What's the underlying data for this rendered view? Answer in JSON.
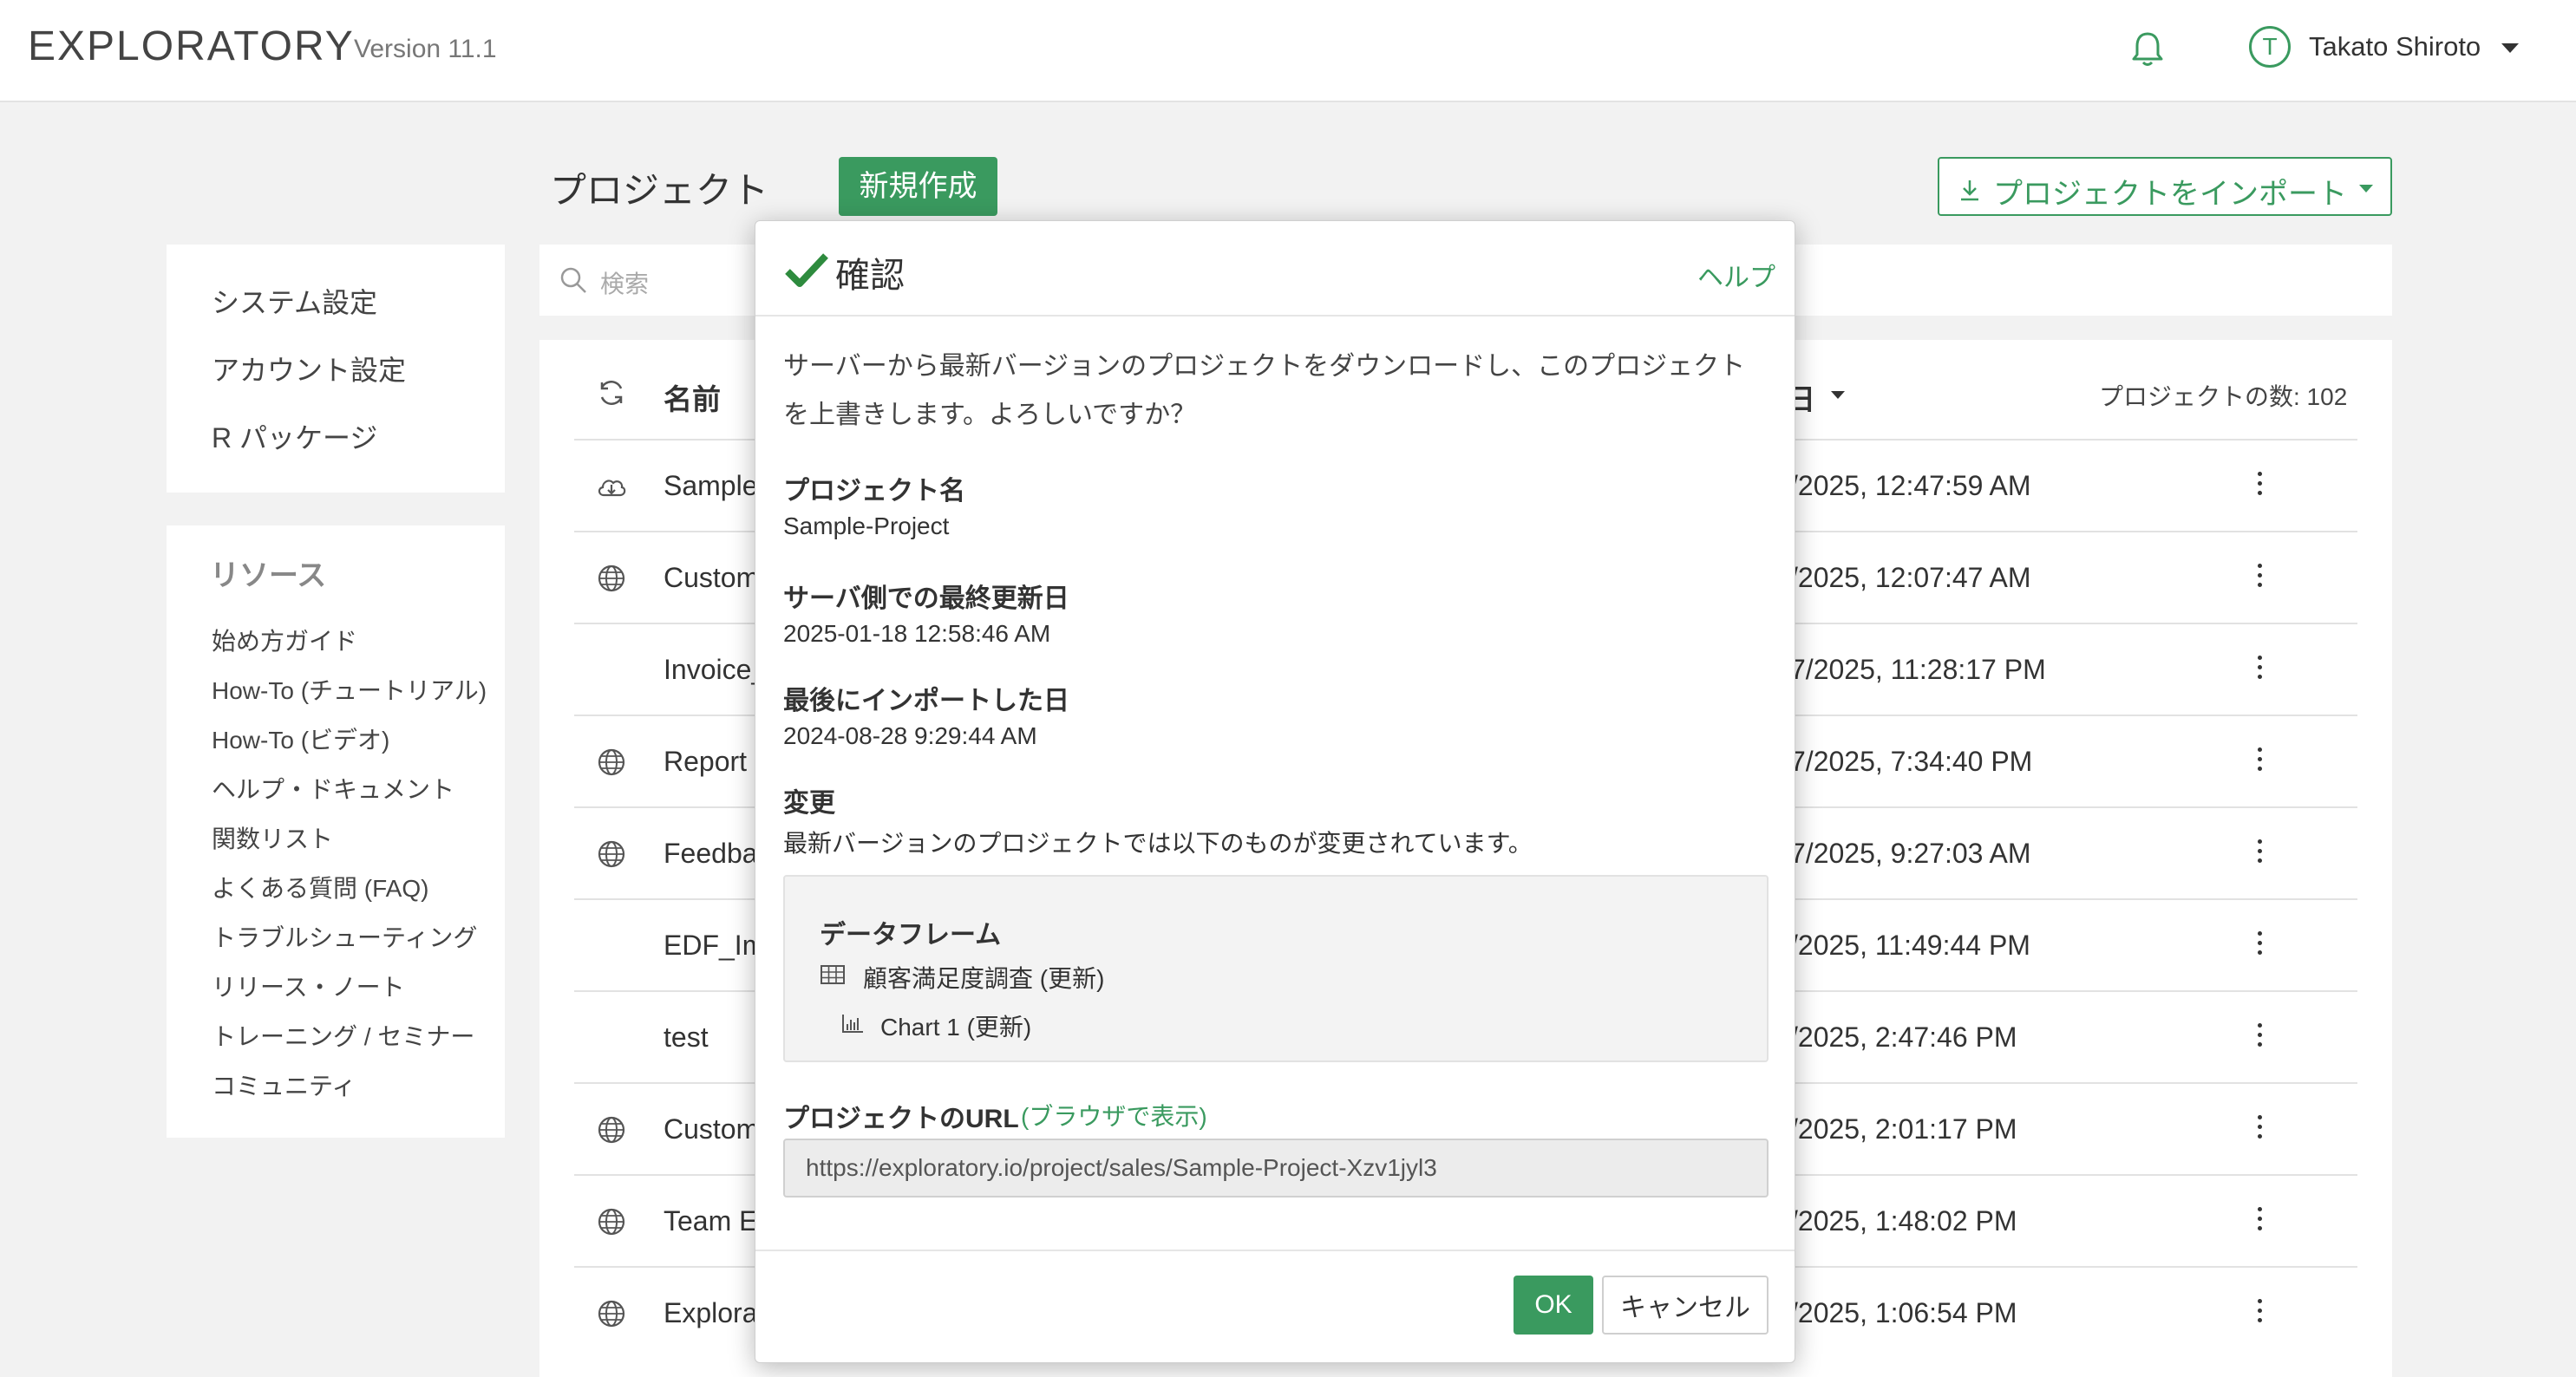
{
  "header": {
    "brand": "EXPLORATORY",
    "version": "Version 11.1",
    "user_initial": "T",
    "user_name": "Takato Shiroto"
  },
  "toolbar": {
    "page_title": "プロジェクト",
    "new_label": "新規作成",
    "import_label": "プロジェクトをインポート"
  },
  "sidebar": {
    "settings": [
      "システム設定",
      "アカウント設定",
      "R パッケージ"
    ],
    "resources_heading": "リソース",
    "resources": [
      "始め方ガイド",
      "How-To (チュートリアル)",
      "How-To (ビデオ)",
      "ヘルプ・ドキュメント",
      "関数リスト",
      "よくある質問 (FAQ)",
      "トラブルシューティング",
      "リリース・ノート",
      "トレーニング / セミナー",
      "コミュニティ"
    ]
  },
  "search": {
    "placeholder": "検索"
  },
  "table": {
    "col_name": "名前",
    "col_date": "日",
    "count_label": "プロジェクトの数: 102",
    "rows": [
      {
        "icon": "cloud-download-icon",
        "name": "Sample",
        "date": "/2025, 12:47:59 AM"
      },
      {
        "icon": "globe-icon",
        "name": "Custom",
        "date": "/2025, 12:07:47 AM"
      },
      {
        "icon": "",
        "name": "Invoice_",
        "date": "7/2025, 11:28:17 PM"
      },
      {
        "icon": "globe-icon",
        "name": "Report",
        "date": "7/2025, 7:34:40 PM"
      },
      {
        "icon": "globe-icon",
        "name": "Feedba",
        "date": "7/2025, 9:27:03 AM"
      },
      {
        "icon": "",
        "name": "EDF_Im",
        "date": "/2025, 11:49:44 PM"
      },
      {
        "icon": "",
        "name": "test",
        "date": "/2025, 2:47:46 PM"
      },
      {
        "icon": "globe-icon",
        "name": "Custom",
        "date": "/2025, 2:01:17 PM"
      },
      {
        "icon": "globe-icon",
        "name": "Team E",
        "date": "/2025, 1:48:02 PM"
      },
      {
        "icon": "globe-icon",
        "name": "Explora",
        "date": "/2025, 1:06:54 PM"
      }
    ]
  },
  "modal": {
    "title": "確認",
    "help": "ヘルプ",
    "message": "サーバーから最新バージョンのプロジェクトをダウンロードし、このプロジェクトを上書きします。よろしいですか？",
    "project_name_label": "プロジェクト名",
    "project_name": "Sample-Project",
    "server_updated_label": "サーバ側での最終更新日",
    "server_updated": "2025-01-18 12:58:46 AM",
    "last_import_label": "最後にインポートした日",
    "last_import": "2024-08-28 9:29:44 AM",
    "changes_label": "変更",
    "changes_desc": "最新バージョンのプロジェクトでは以下のものが変更されています。",
    "changes": {
      "section": "データフレーム",
      "dataframe": "顧客満足度調査 (更新)",
      "chart": "Chart 1 (更新)"
    },
    "url_label": "プロジェクトのURL",
    "url_link": "(ブラウザで表示)",
    "url": "https://exploratory.io/project/sales/Sample-Project-Xzv1jyl3",
    "ok": "OK",
    "cancel": "キャンセル"
  },
  "colors": {
    "accent": "#3a9a5f"
  }
}
